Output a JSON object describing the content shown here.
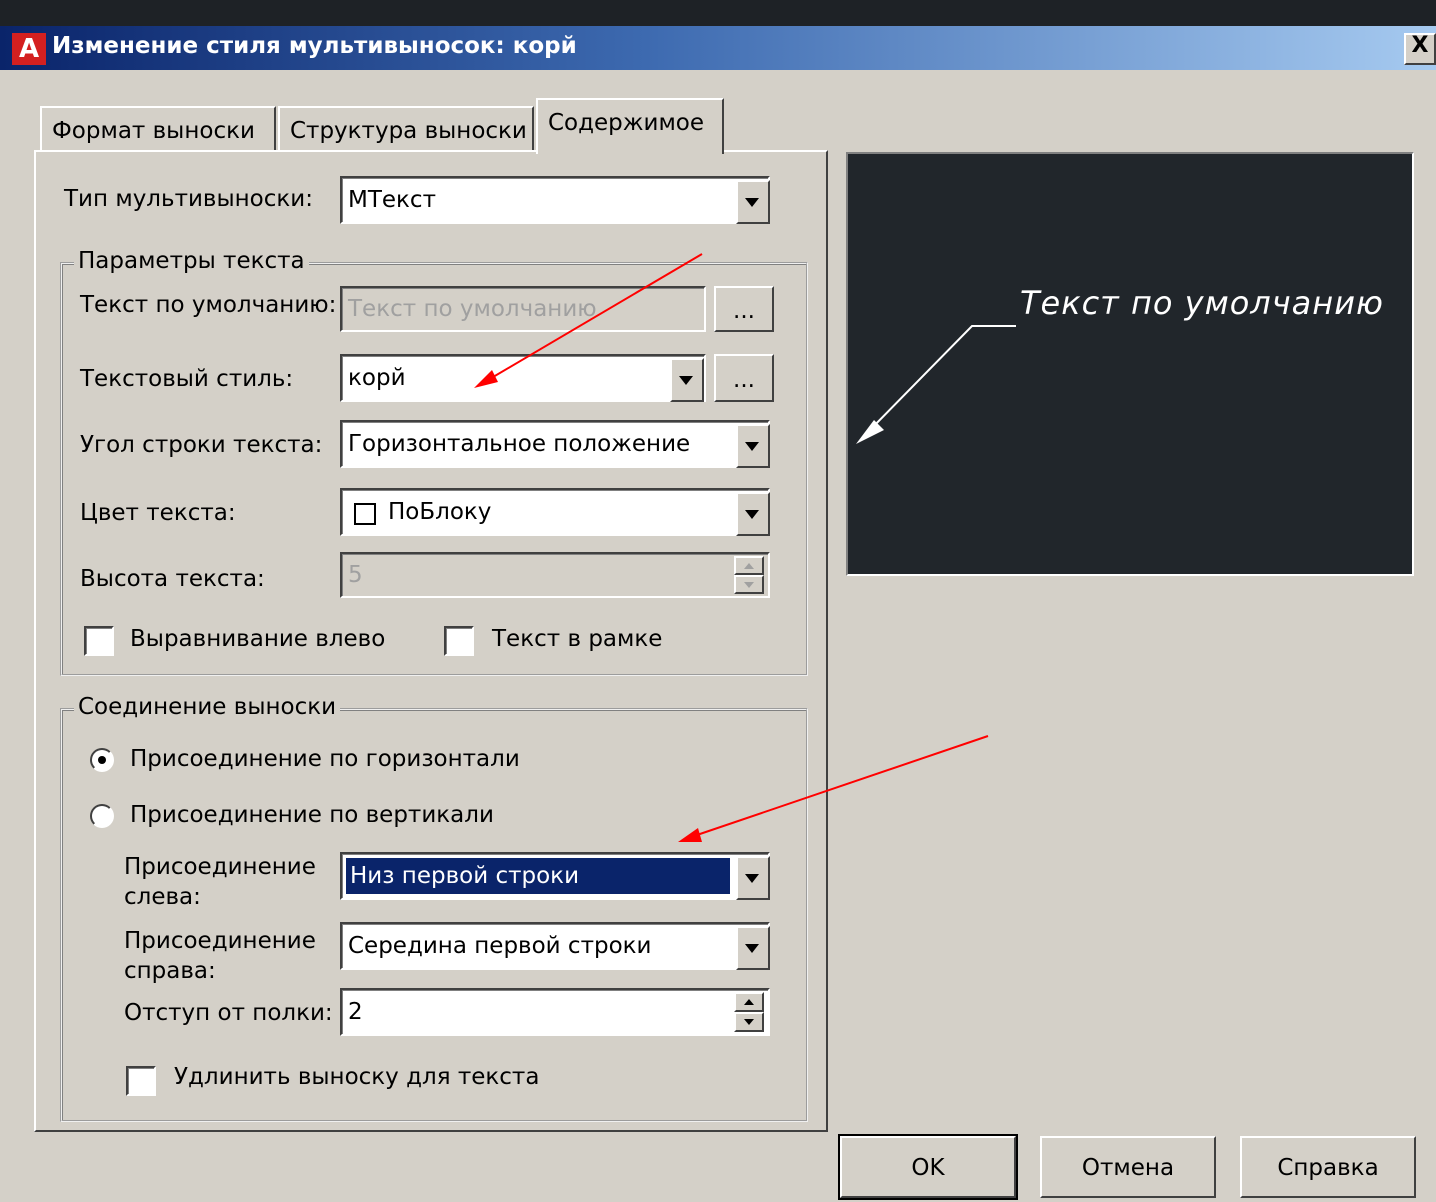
{
  "dialog": {
    "title": "Изменение стиля мультивыносок: корй",
    "close_label": "X"
  },
  "tabs": [
    {
      "label": "Формат выноски",
      "active": false
    },
    {
      "label": "Структура выноски",
      "active": false
    },
    {
      "label": "Содержимое",
      "active": true
    }
  ],
  "content": {
    "multileader_type": {
      "label": "Тип мультивыноски:",
      "value": "МТекст"
    },
    "text_options": {
      "group_title": "Параметры текста",
      "default_text": {
        "label": "Текст по умолчанию:",
        "value": "Текст по умолчанию",
        "button": "..."
      },
      "text_style": {
        "label": "Текстовый стиль:",
        "value": "корй",
        "button": "..."
      },
      "text_angle": {
        "label": "Угол строки текста:",
        "value": "Горизонтальное положение"
      },
      "text_color": {
        "label": "Цвет текста:",
        "value": "ПоБлоку"
      },
      "text_height": {
        "label": "Высота текста:",
        "value": "5"
      },
      "left_justify": {
        "label": "Выравнивание влево",
        "checked": false
      },
      "frame_text": {
        "label": "Текст в рамке",
        "checked": false
      }
    },
    "leader_connection": {
      "group_title": "Соединение выноски",
      "horizontal": {
        "label": "Присоединение по горизонтали",
        "selected": true
      },
      "vertical": {
        "label": "Присоединение по вертикали",
        "selected": false
      },
      "left_attachment": {
        "label_line1": "Присоединение",
        "label_line2": "слева:",
        "value": "Низ первой строки"
      },
      "right_attachment": {
        "label_line1": "Присоединение",
        "label_line2": "справа:",
        "value": "Середина первой строки"
      },
      "landing_gap": {
        "label": "Отступ от полки:",
        "value": "2"
      },
      "extend_leader": {
        "label": "Удлинить выноску для текста",
        "checked": false
      }
    }
  },
  "preview": {
    "text": "Текст по умолчанию"
  },
  "buttons": {
    "ok": "OK",
    "cancel": "Отмена",
    "help": "Справка"
  },
  "colors": {
    "titlebar": "#0a246a",
    "preview_bg": "#21262b",
    "annotation_arrow": "#ff0000"
  }
}
